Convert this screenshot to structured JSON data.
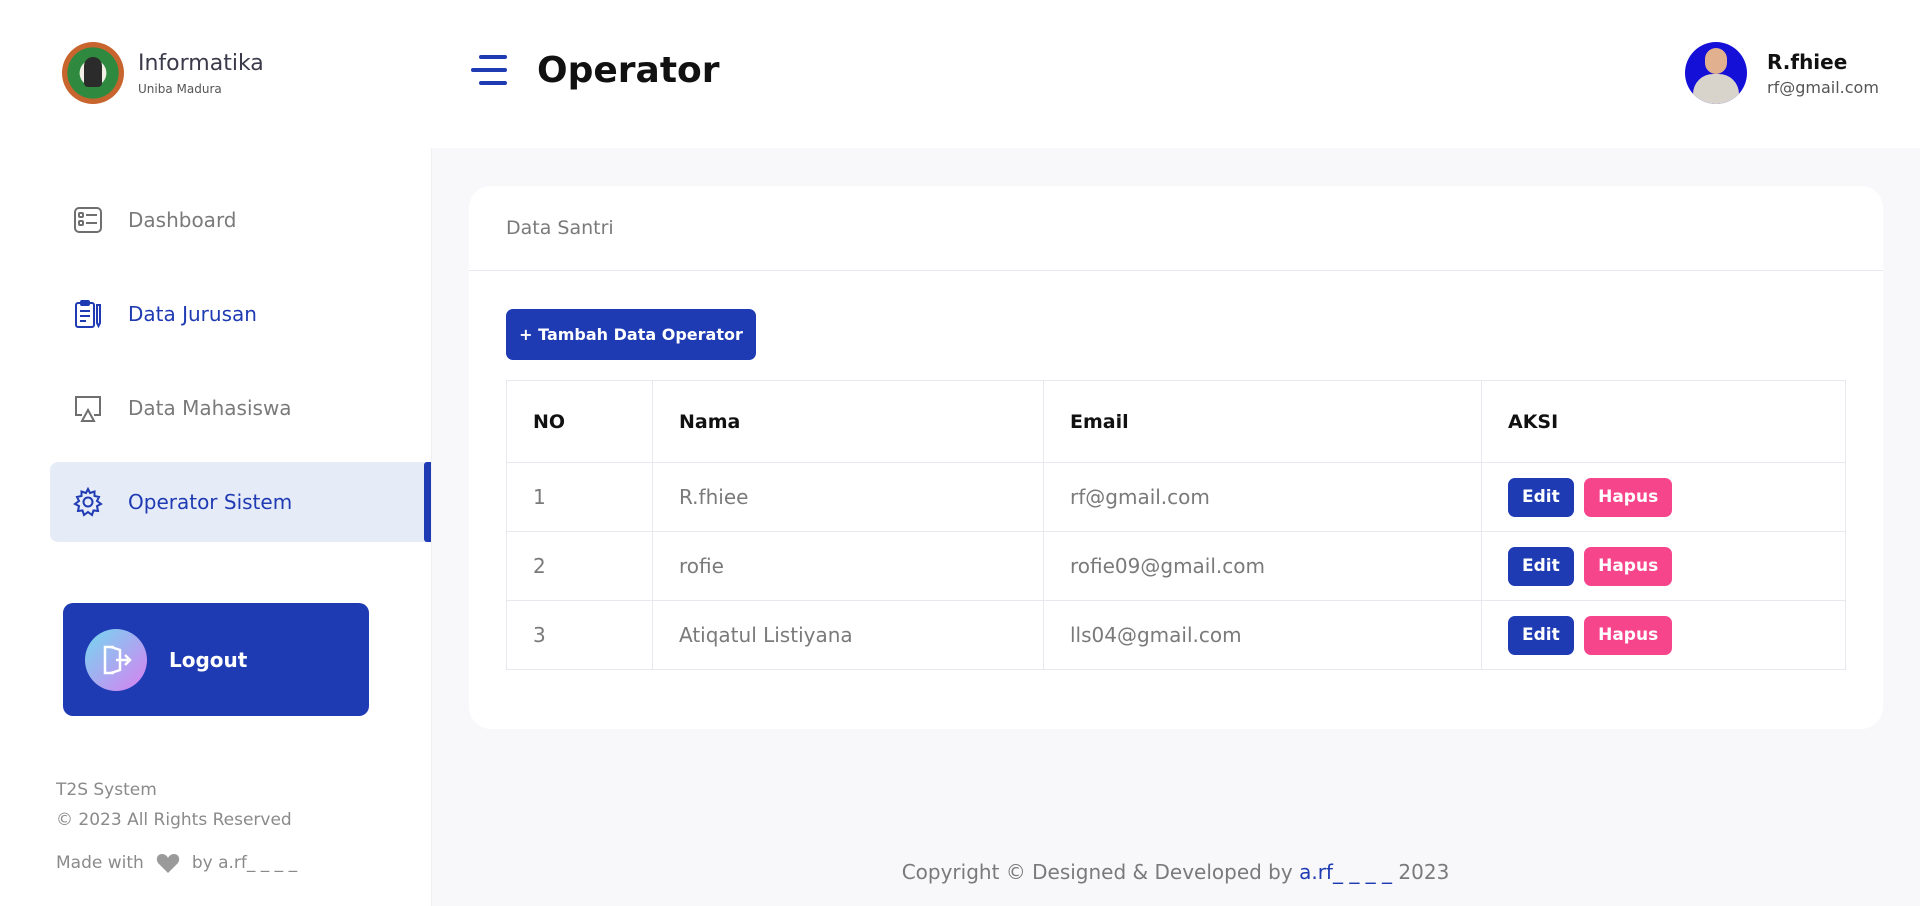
{
  "brand": {
    "name": "Informatika",
    "subtitle": "Uniba Madura"
  },
  "sidebar": {
    "items": [
      {
        "label": "Dashboard",
        "icon": "dashboard-icon"
      },
      {
        "label": "Data Jurusan",
        "icon": "clipboard-icon"
      },
      {
        "label": "Data Mahasiswa",
        "icon": "monitor-icon"
      },
      {
        "label": "Operator Sistem",
        "icon": "gear-icon",
        "active": true
      }
    ],
    "logout_label": "Logout",
    "footer": {
      "system": "T2S System",
      "rights": "© 2023 All Rights Reserved",
      "made_with": "Made with",
      "by": "by a.rf_ _ _ _"
    }
  },
  "header": {
    "title": "Operator",
    "user": {
      "name": "R.fhiee",
      "email": "rf@gmail.com"
    }
  },
  "card": {
    "title": "Data Santri",
    "add_button": "+ Tambah Data Operator",
    "columns": [
      "NO",
      "Nama",
      "Email",
      "AKSI"
    ],
    "rows": [
      {
        "no": "1",
        "nama": "R.fhiee",
        "email": "rf@gmail.com"
      },
      {
        "no": "2",
        "nama": "rofie",
        "email": "rofie09@gmail.com"
      },
      {
        "no": "3",
        "nama": "Atiqatul Listiyana",
        "email": "lls04@gmail.com"
      }
    ],
    "edit_label": "Edit",
    "delete_label": "Hapus"
  },
  "footer": {
    "prefix": "Copyright © Designed & Developed by",
    "author": "a.rf_ _ _ _",
    "year": "2023"
  },
  "colors": {
    "accent": "#1f3bb3",
    "danger": "#f7458b",
    "active_bg": "#e6ebf8"
  }
}
